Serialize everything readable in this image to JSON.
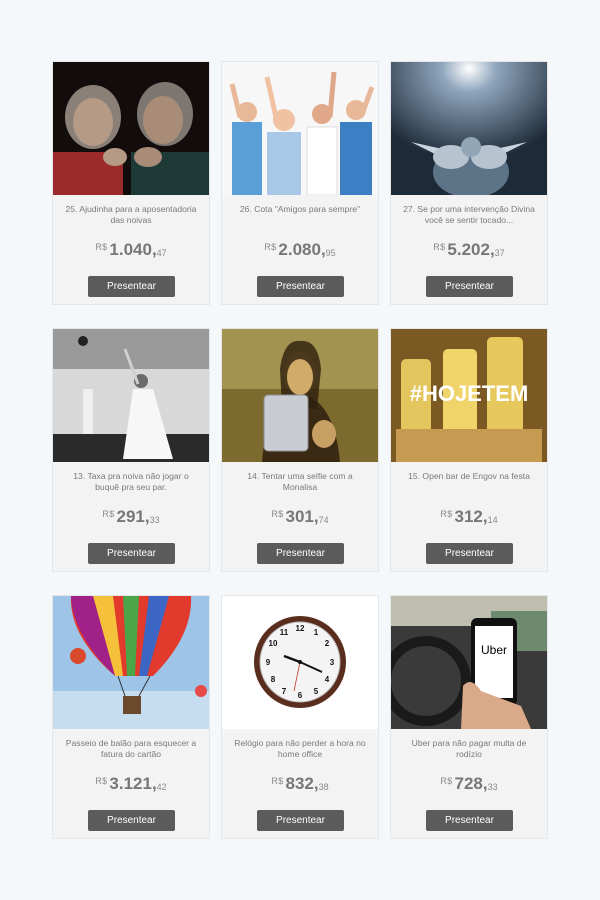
{
  "gifts": [
    {
      "title": "25. Ajudinha para a aposentadoria das noivas",
      "currency": "R$",
      "price_int": "1.040,",
      "price_cents": "47",
      "button": "Presentear",
      "image": "elderly-women-laughing"
    },
    {
      "title": "26. Cota \"Amigos para sempre\"",
      "currency": "R$",
      "price_int": "2.080,",
      "price_cents": "95",
      "button": "Presentear",
      "image": "group-cheering"
    },
    {
      "title": "27. Se por uma intervenção Divina você se sentir tocado...",
      "currency": "R$",
      "price_int": "5.202,",
      "price_cents": "37",
      "button": "Presentear",
      "image": "divine-hands"
    },
    {
      "title": "13. Taxa pra noiva não jogar o buquê pra seu par.",
      "currency": "R$",
      "price_int": "291,",
      "price_cents": "33",
      "button": "Presentear",
      "image": "bride-bouquet"
    },
    {
      "title": "14. Tentar uma selfie com a Monalisa",
      "currency": "R$",
      "price_int": "301,",
      "price_cents": "74",
      "button": "Presentear",
      "image": "monalisa-selfie"
    },
    {
      "title": "15. Open bar de Engov na festa",
      "currency": "R$",
      "price_int": "312,",
      "price_cents": "14",
      "button": "Presentear",
      "image": "engov-hojetem",
      "image_text": "#HOJETEM"
    },
    {
      "title": "Passeio de balão para esquecer a fatura do cartão",
      "currency": "R$",
      "price_int": "3.121,",
      "price_cents": "42",
      "button": "Presentear",
      "image": "hot-air-balloon"
    },
    {
      "title": "Relógio para não perder a hora no home office",
      "currency": "R$",
      "price_int": "832,",
      "price_cents": "38",
      "button": "Presentear",
      "image": "wall-clock"
    },
    {
      "title": "Uber para não pagar multa de rodízio",
      "currency": "R$",
      "price_int": "728,",
      "price_cents": "33",
      "button": "Presentear",
      "image": "uber-phone",
      "image_text": "Uber"
    }
  ],
  "colors": {
    "page_bg": "#f5f8fa",
    "card_bg": "#f3f3f3",
    "button_bg": "#5b5b5b"
  }
}
